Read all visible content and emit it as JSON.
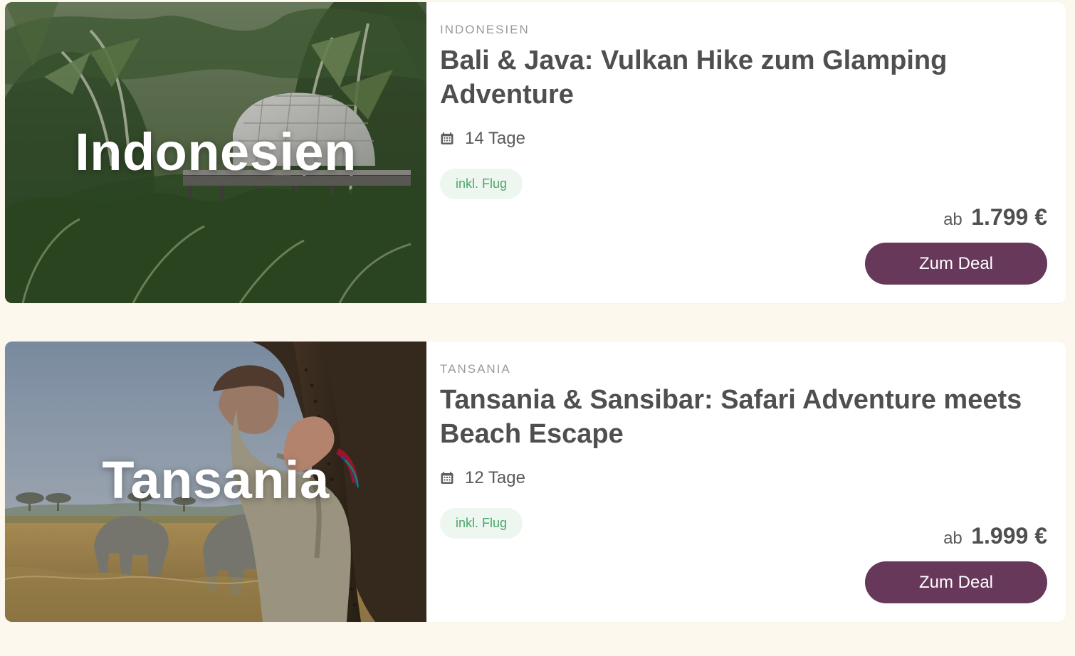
{
  "deals": [
    {
      "image_title": "Indonesien",
      "region": "INDONESIEN",
      "title": "Bali & Java: Vulkan Hike zum Glamping Adventure",
      "duration": "14 Tage",
      "badge": "inkl. Flug",
      "price_prefix": "ab",
      "price": "1.799 €",
      "button_label": "Zum Deal",
      "icon": "calendar-icon"
    },
    {
      "image_title": "Tansania",
      "region": "TANSANIA",
      "title": "Tansania & Sansibar: Safari Adventure meets Beach Escape",
      "duration": "12 Tage",
      "badge": "inkl. Flug",
      "price_prefix": "ab",
      "price": "1.999 €",
      "button_label": "Zum Deal",
      "icon": "calendar-icon"
    }
  ],
  "colors": {
    "page_background": "#fdf8ee",
    "card_background": "#ffffff",
    "button_background": "#673859",
    "badge_background": "#eef6f0",
    "badge_text": "#4aa66a",
    "title_text": "#4f4f4f",
    "region_text": "#9a9a9a"
  }
}
